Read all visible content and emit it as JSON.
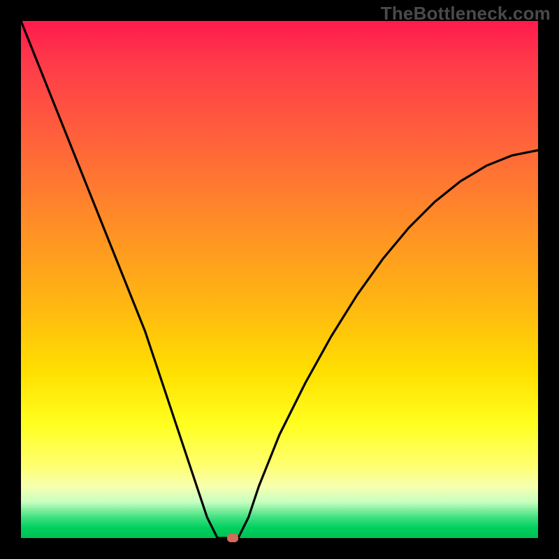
{
  "watermark": "TheBottleneck.com",
  "colors": {
    "frame": "#000000",
    "watermark": "#4a4a4a",
    "curve": "#000000",
    "marker": "#d46a5a",
    "gradient_stops": [
      "#ff1a4d",
      "#ff3a4a",
      "#ff5a3e",
      "#ff7a30",
      "#ff9a20",
      "#ffba10",
      "#ffe000",
      "#ffff20",
      "#ffff70",
      "#f7ffb0",
      "#c8ffc0",
      "#40e080",
      "#00d060",
      "#00c050"
    ]
  },
  "chart_data": {
    "type": "line",
    "title": "",
    "xlabel": "",
    "ylabel": "",
    "x_range": [
      0,
      100
    ],
    "y_range": [
      0,
      100
    ],
    "notes": "x and y are in percent of the inner plot area (0 = left/bottom, 100 = right/top). Curve values are estimated from the pixel positions; the minimum reaches 0 near x≈40. No axis tick labels are shown in the image.",
    "series": [
      {
        "name": "bottleneck-curve",
        "x": [
          0,
          2,
          4,
          6,
          8,
          10,
          12,
          14,
          16,
          18,
          20,
          22,
          24,
          26,
          28,
          30,
          32,
          34,
          36,
          38,
          40,
          42,
          44,
          46,
          50,
          55,
          60,
          65,
          70,
          75,
          80,
          85,
          90,
          95,
          100
        ],
        "y": [
          100,
          95,
          90,
          85,
          80,
          75,
          70,
          65,
          60,
          55,
          50,
          45,
          40,
          34,
          28,
          22,
          16,
          10,
          4,
          0,
          0,
          0,
          4,
          10,
          20,
          30,
          39,
          47,
          54,
          60,
          65,
          69,
          72,
          74,
          75
        ]
      }
    ],
    "marker": {
      "x": 41,
      "y": 0
    },
    "flat_segment": {
      "x_start": 38,
      "x_end": 42,
      "y": 0
    }
  }
}
